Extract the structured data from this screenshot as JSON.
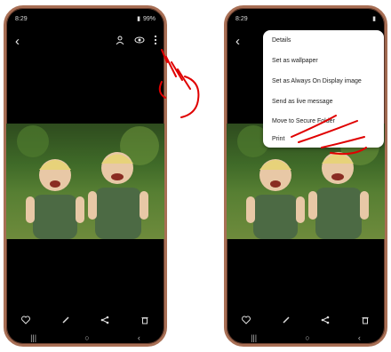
{
  "status": {
    "time": "8:29",
    "battery": "99%"
  },
  "photo_actions": {
    "back": "back-arrow-icon",
    "top_icons": [
      "share-person-icon",
      "eye-icon",
      "more-vert-icon"
    ],
    "bottom_icons": [
      "heart-icon",
      "pencil-icon",
      "share-icon",
      "trash-icon"
    ]
  },
  "menu": {
    "items": [
      "Details",
      "Set as wallpaper",
      "Set as Always On Display image",
      "Send as live message",
      "Move to Secure Folder",
      "Print"
    ]
  },
  "colors": {
    "frame": "#a86f55",
    "annotation": "#e00000"
  }
}
